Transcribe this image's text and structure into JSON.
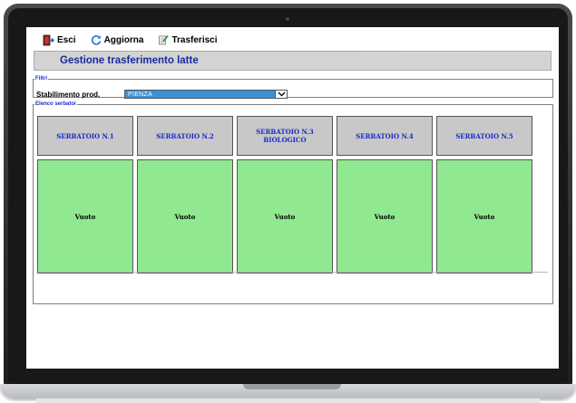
{
  "toolbar": {
    "exit_label": "Esci",
    "refresh_label": "Aggiorna",
    "transfer_label": "Trasferisci"
  },
  "page": {
    "title": "Gestione trasferimento latte"
  },
  "filters": {
    "legend": "Filtri",
    "plant_label": "Stabilimento prod.",
    "plant_value": "PIENZA"
  },
  "tanks": {
    "legend": "Elenco serbatoi",
    "items": [
      {
        "name": "SERBATOIO N.1",
        "status": "Vuoto"
      },
      {
        "name": "SERBATOIO N.2",
        "status": "Vuoto"
      },
      {
        "name": "SERBATOIO N.3 BIOLOGICO",
        "status": "Vuoto"
      },
      {
        "name": "SERBATOIO N.4",
        "status": "Vuoto"
      },
      {
        "name": "SERBATOIO N.5",
        "status": "Vuoto"
      }
    ]
  },
  "colors": {
    "title_text": "#1a2a9e",
    "tank_empty_fill": "#90e890",
    "tank_header_fill": "#c8c8c8",
    "select_fill": "#3b90d9"
  },
  "icons": [
    "exit-icon",
    "refresh-icon",
    "transfer-icon",
    "chevron-down-icon"
  ]
}
